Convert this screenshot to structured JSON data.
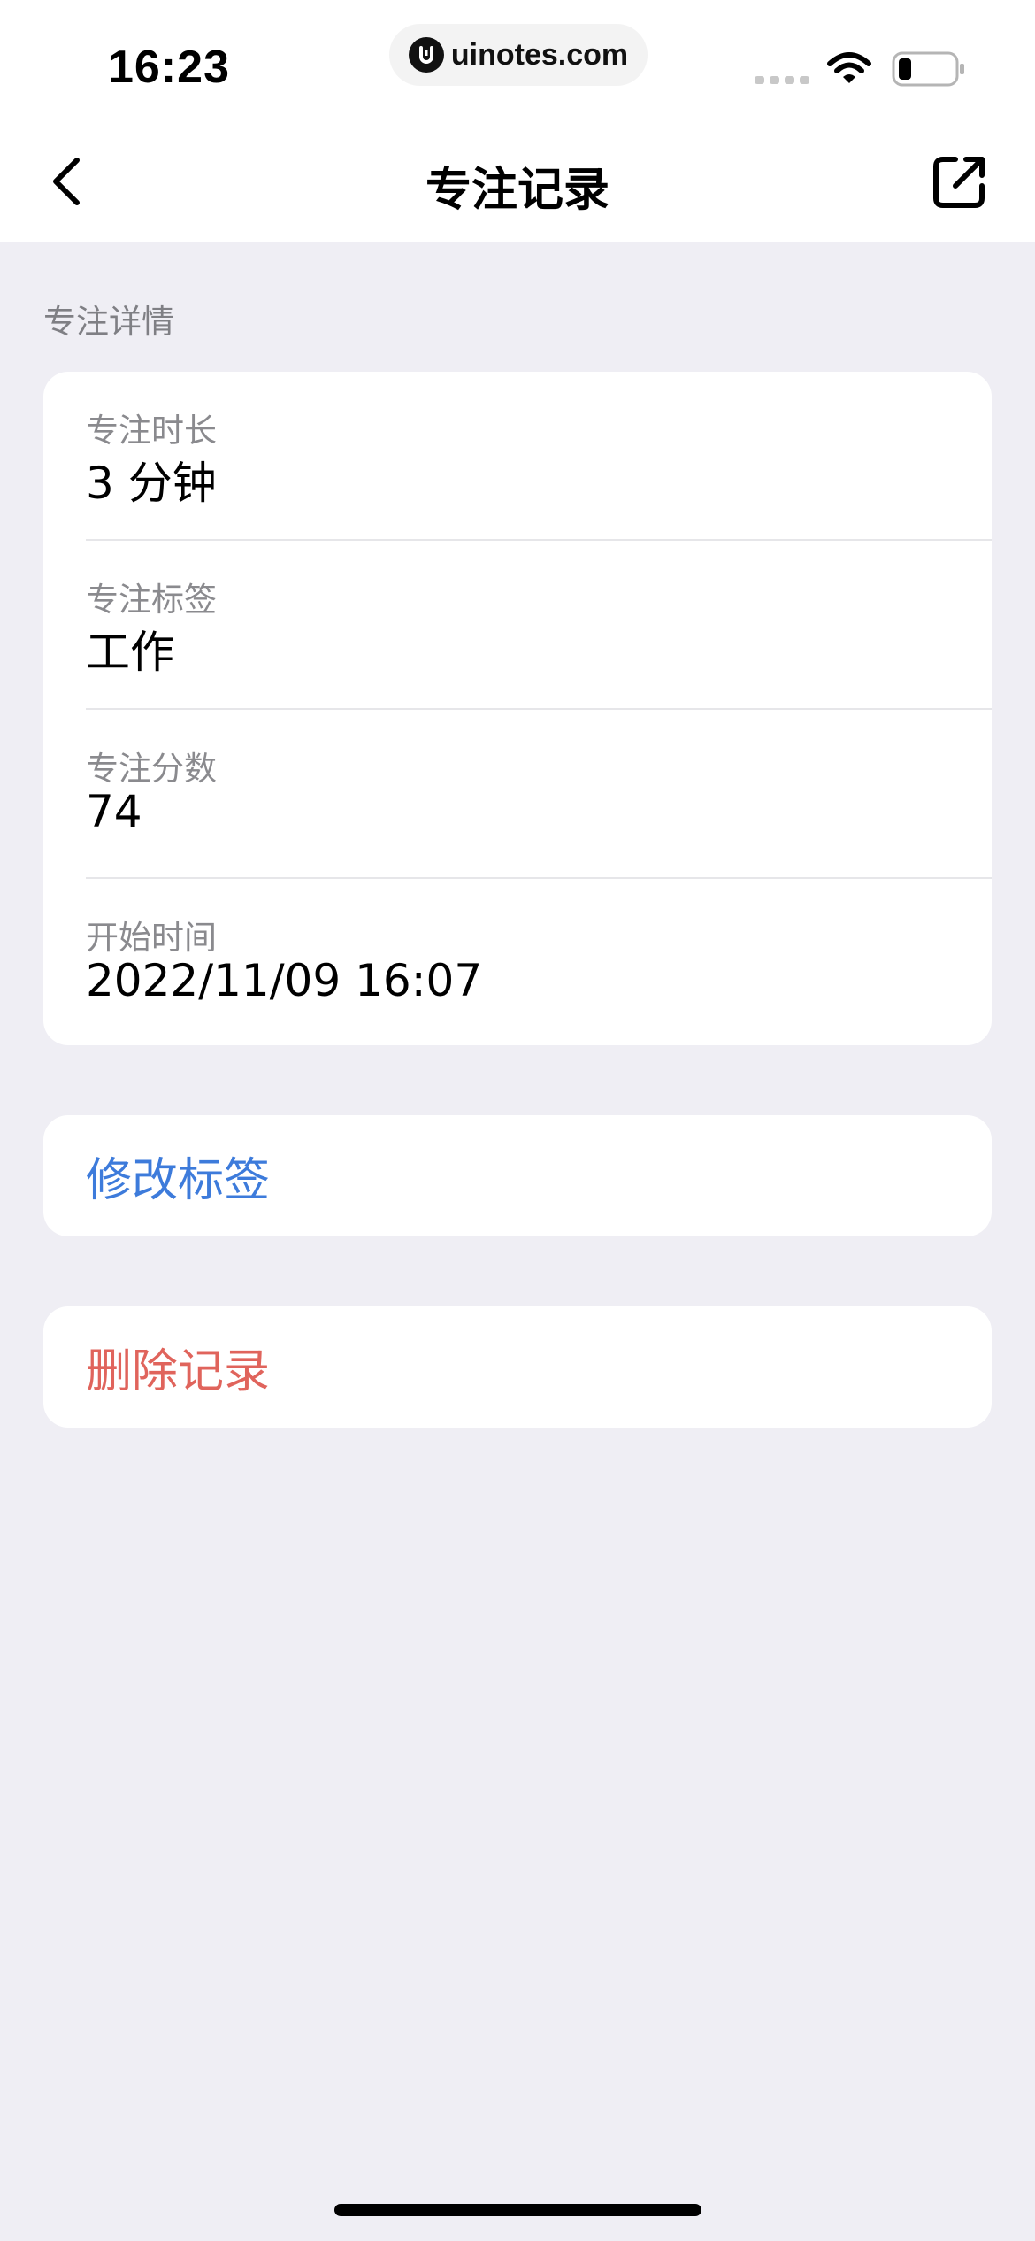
{
  "status_bar": {
    "time": "16:23",
    "url_pill": "uinotes.com",
    "icons": [
      "signal-icon",
      "wifi-icon",
      "battery-icon"
    ]
  },
  "nav": {
    "title": "专注记录",
    "back_icon": "chevron-left-icon",
    "share_icon": "share-icon"
  },
  "section": {
    "header": "专注详情"
  },
  "details": [
    {
      "label": "专注时长",
      "value": "3 分钟"
    },
    {
      "label": "专注标签",
      "value": "工作"
    },
    {
      "label": "专注分数",
      "value": "74"
    },
    {
      "label": "开始时间",
      "value": "2022/11/09 16:07"
    }
  ],
  "actions": {
    "edit_tag": "修改标签",
    "delete_record": "删除记录"
  },
  "colors": {
    "background": "#EFEEF4",
    "card": "#FFFFFF",
    "link_blue": "#3D7BDB",
    "destructive_red": "#E0645C",
    "secondary_text": "#8A8A8E"
  }
}
